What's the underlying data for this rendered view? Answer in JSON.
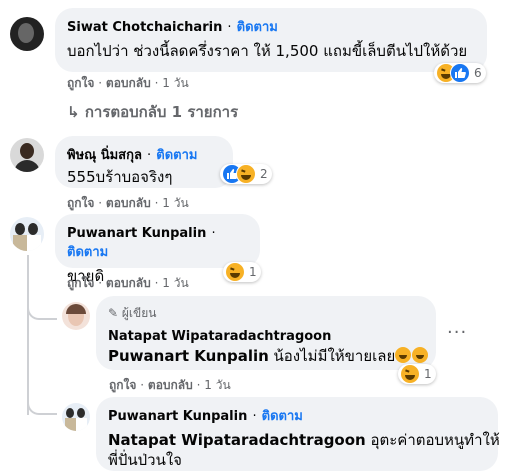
{
  "comments": [
    {
      "author": "Siwat Chotchaicharin",
      "text": "บอกไปว่า ช่วงนี้ลดครึ่งราคา ให้ 1,500 แถมขี้เล็บตีนไปให้ด้วย",
      "reactions": {
        "types": [
          "haha-icon",
          "like-icon"
        ],
        "count": "6"
      },
      "actions": {
        "like": "ถูกใจ",
        "reply": "ตอบกลับ",
        "time": "1 วัน"
      },
      "replies_label": "การตอบกลับ 1 รายการ"
    },
    {
      "author": "พิษณุ นิ่มสกุล",
      "follow": "ติดตาม",
      "text": "555บร้าบอจริงๆ",
      "reactions": {
        "types": [
          "like-icon",
          "haha-icon"
        ],
        "count": "2"
      },
      "actions": {
        "like": "ถูกใจ",
        "reply": "ตอบกลับ",
        "time": "1 วัน"
      }
    },
    {
      "author": "Puwanart Kunpalin",
      "follow": "ติดตาม",
      "text": "ขายดิ",
      "reactions": {
        "types": [
          "haha-icon"
        ],
        "count": "1"
      },
      "actions": {
        "like": "ถูกใจ",
        "reply": "ตอบกลับ",
        "time": "1 วัน"
      }
    }
  ],
  "reply1": {
    "badge": "ผู้เขียน",
    "author": "Natapat Wipataradachtragoon",
    "tag": "Puwanart Kunpalin",
    "text": " น้องไม่มีให้ขายเลย",
    "reactions": {
      "types": [
        "haha-icon"
      ],
      "count": "1"
    },
    "actions": {
      "like": "ถูกใจ",
      "reply": "ตอบกลับ",
      "time": "1 วัน"
    },
    "more": "···"
  },
  "reply2": {
    "author": "Puwanart Kunpalin",
    "follow": "ติดตาม",
    "tag": "Natapat Wipataradachtragoon",
    "text_line1": " อุตะค่าตอบหนูทำให้",
    "text_line2": "พี่ปั่นป่วนใจ"
  },
  "follow_label": "ติดตาม",
  "separator": "·"
}
